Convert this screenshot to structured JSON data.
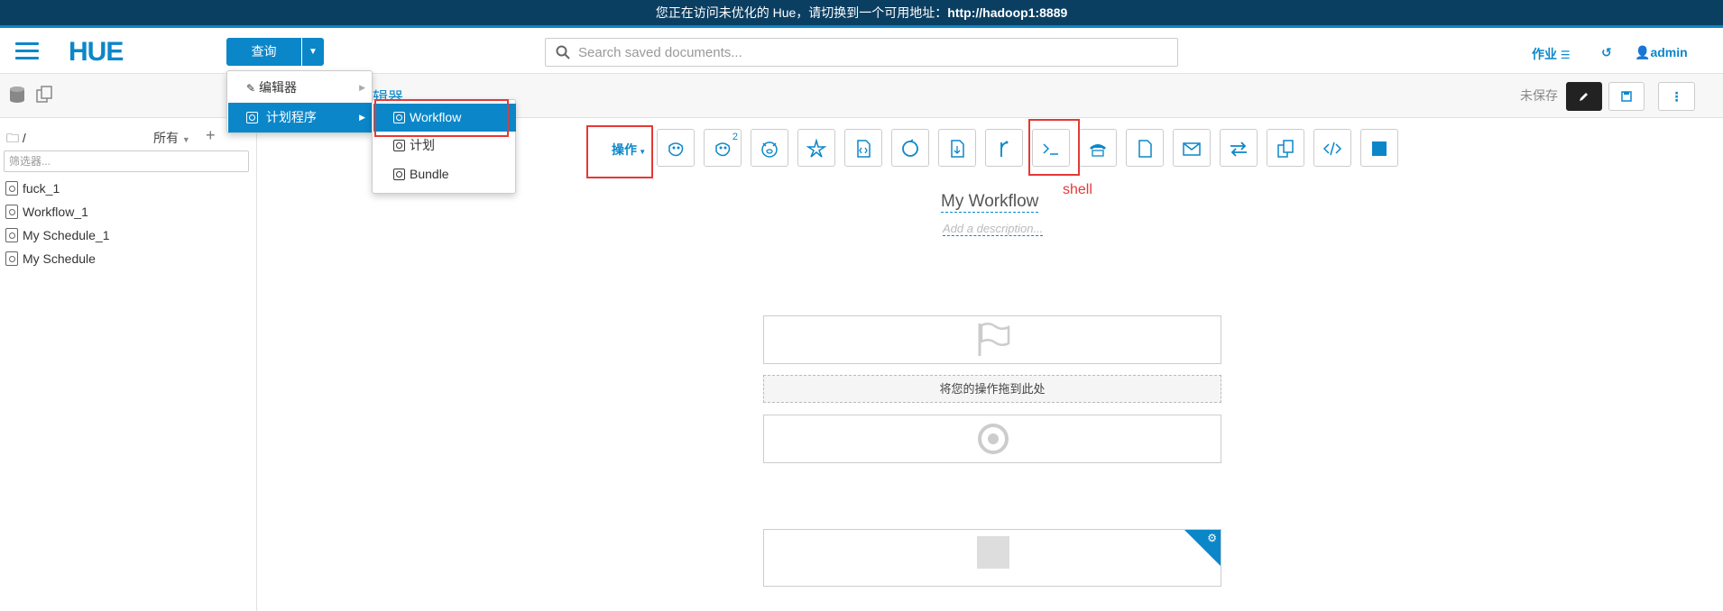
{
  "banner": {
    "text": "您正在访问未优化的 Hue，请切换到一个可用地址：",
    "url": "http://hadoop1:8889"
  },
  "navbar": {
    "logo": "HUE",
    "query_button": "查询",
    "search_placeholder": "Search saved documents...",
    "jobs_label": "作业",
    "user_label": "admin"
  },
  "toolbar": {
    "breadcrumb_partial": "辑器",
    "unsaved_label": "未保存"
  },
  "left_panel": {
    "path": "/",
    "filter_all": "所有",
    "filter_placeholder": "筛选器...",
    "files": [
      "fuck_1",
      "Workflow_1",
      "My Schedule_1",
      "My Schedule"
    ]
  },
  "query_menu": {
    "items": [
      {
        "label": "编辑器"
      },
      {
        "label": "计划程序"
      }
    ],
    "submenu": [
      {
        "label": "Workflow"
      },
      {
        "label": "计划"
      },
      {
        "label": "Bundle"
      }
    ]
  },
  "actions": {
    "label": "操作",
    "hive2_badge": "2",
    "shell_annotation": "shell",
    "icons": [
      "hive-icon",
      "hive2-icon",
      "pig-icon",
      "spark-icon",
      "java-icon",
      "sqoop-icon",
      "mapreduce-icon",
      "subworkflow-icon",
      "shell-icon",
      "ssh-icon",
      "fs-icon",
      "email-icon",
      "streaming-icon",
      "distcp-icon",
      "generic-icon",
      "kill-icon"
    ]
  },
  "workflow": {
    "name": "My Workflow",
    "description_placeholder": "Add a description...",
    "drop_text": "将您的操作拖到此处"
  },
  "colors": {
    "accent": "#0b87c9",
    "banner": "#0b3f62",
    "highlight": "#e53935"
  }
}
